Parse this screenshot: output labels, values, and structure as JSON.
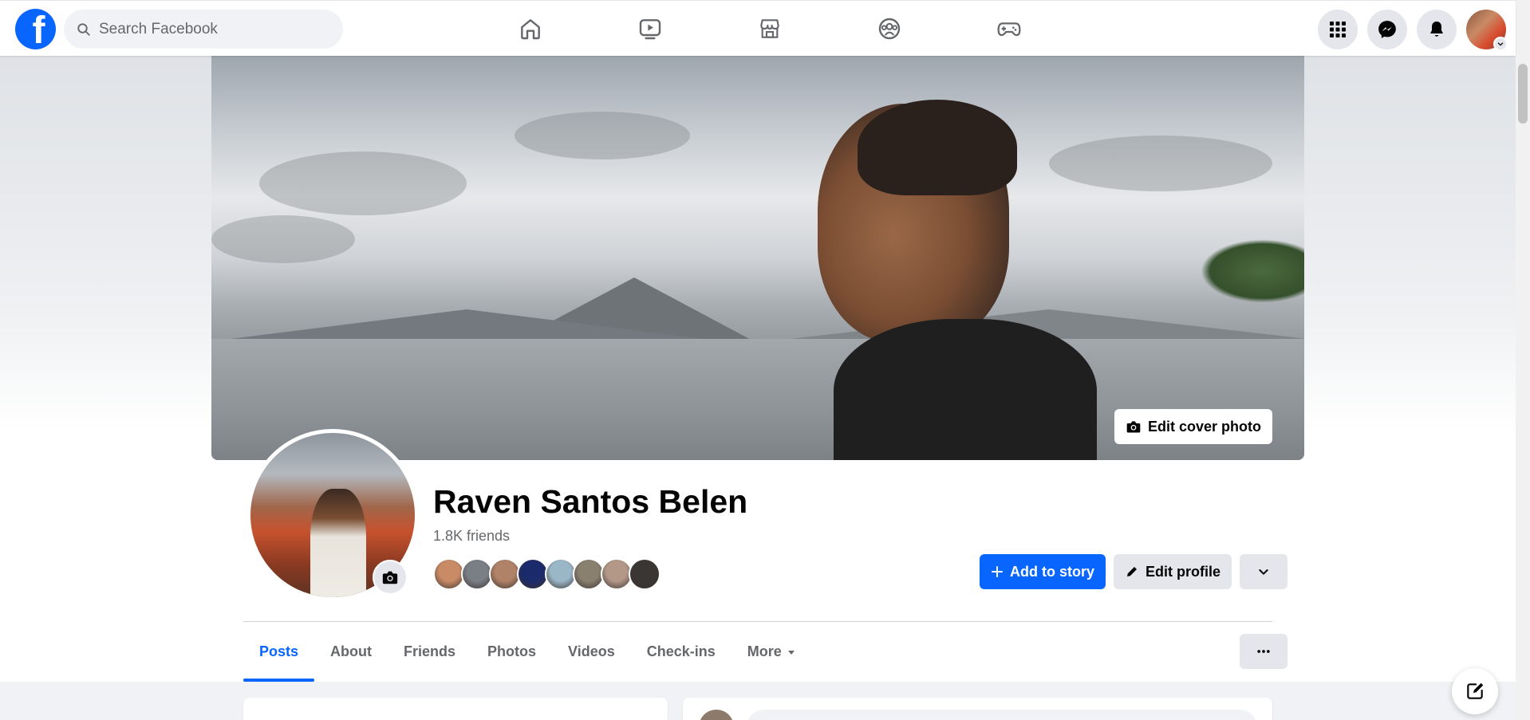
{
  "topbar": {
    "logo_letter": "f",
    "search_placeholder": "Search Facebook",
    "nav_icons": [
      "home-icon",
      "watch-icon",
      "marketplace-icon",
      "groups-icon",
      "gaming-icon"
    ],
    "right_icons": [
      "menu-grid-icon",
      "messenger-icon",
      "notifications-icon",
      "account-avatar"
    ]
  },
  "cover": {
    "edit_cover_label": "Edit cover photo"
  },
  "profile": {
    "name": "Raven Santos Belen",
    "friends_count": "1.8K friends",
    "friend_avatar_colors": [
      "#c98a66",
      "#7a7f86",
      "#b08268",
      "#1b2a6b",
      "#9ab7c8",
      "#8a8070",
      "#b39888",
      "#3a3634"
    ]
  },
  "actions": {
    "add_story_label": "Add to story",
    "edit_profile_label": "Edit profile"
  },
  "tabs": {
    "items": [
      "Posts",
      "About",
      "Friends",
      "Photos",
      "Videos",
      "Check-ins",
      "More"
    ],
    "active": "Posts"
  },
  "colors": {
    "brand": "#0866ff",
    "secondary_button": "#e4e6eb",
    "text_secondary": "#65676b"
  }
}
